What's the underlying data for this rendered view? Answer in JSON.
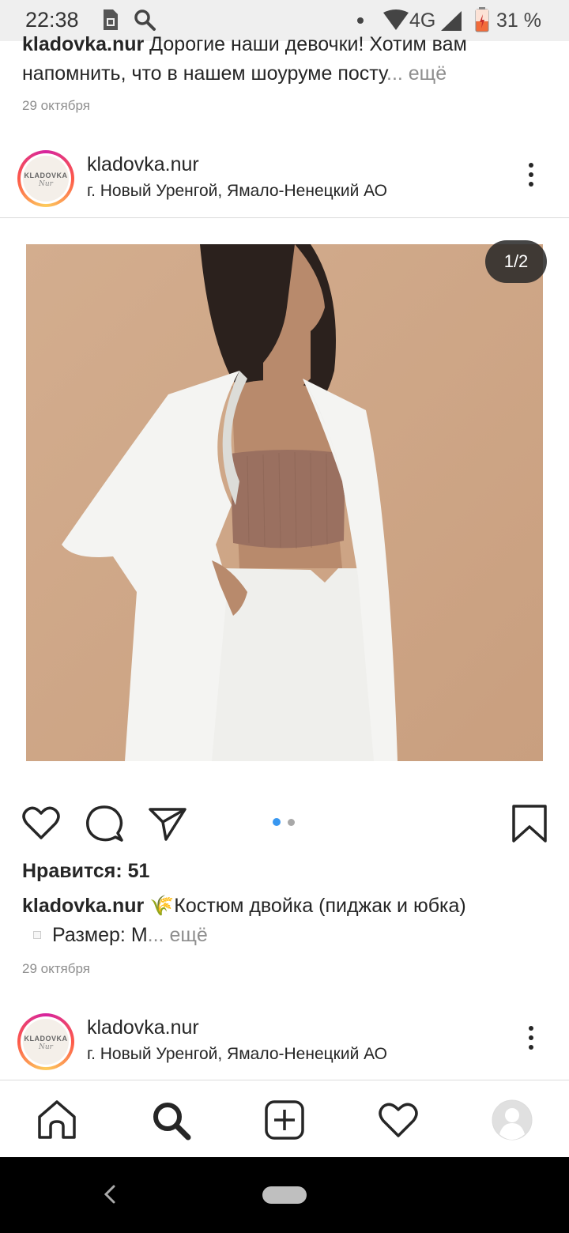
{
  "status_bar": {
    "time": "22:38",
    "network": "4G",
    "battery": "31 %",
    "icons": [
      "sim-icon",
      "search-icon",
      "dot-icon",
      "wifi-icon",
      "signal-icon",
      "battery-icon"
    ]
  },
  "previous_post": {
    "username": "kladovka.nur",
    "caption_text": " Дорогие наши девочки! Хотим вам напомнить, что в нашем шоуруме посту",
    "more_label": "... ещё",
    "date": "29 октября"
  },
  "post": {
    "username": "kladovka.nur",
    "location": "г. Новый Уренгой, Ямало-Ненецкий АО",
    "avatar_text_1": "KLADOVKA",
    "avatar_text_2": "Nur",
    "pager": "1/2",
    "likes_label": "Нравится: 51",
    "caption_user": "kladovka.nur",
    "caption_line1": " 🌾Костюм двойка (пиджак и юбка)",
    "caption_line2": "Размер: M",
    "more_label": "... ещё",
    "date": "29 октября",
    "carousel_total": 2,
    "carousel_active": 1
  },
  "next_post": {
    "username": "kladovka.nur",
    "location": "г. Новый Уренгой, Ямало-Ненецкий АО",
    "avatar_text_1": "KLADOVKA",
    "avatar_text_2": "Nur"
  },
  "bottom_nav": [
    "home-icon",
    "search-icon",
    "add-post-icon",
    "activity-heart-icon",
    "profile-icon"
  ],
  "colors": {
    "accent_blue": "#3897f0",
    "text": "#262626",
    "secondary": "#8e8e8e",
    "photo_background": "#d0a888"
  }
}
